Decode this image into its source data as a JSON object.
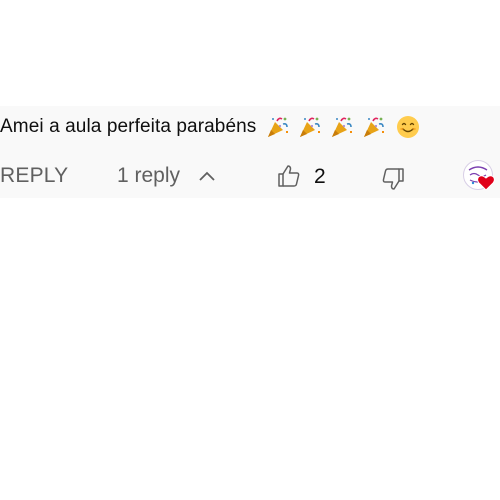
{
  "comment": {
    "text": "Amei a aula perfeita parabéns",
    "emojis": [
      "party-popper-icon",
      "party-popper-icon",
      "party-popper-icon",
      "party-popper-icon",
      "smiling-face-icon"
    ]
  },
  "actions": {
    "reply_label": "REPLY",
    "replies_label": "1 reply",
    "like_count": "2"
  },
  "colors": {
    "strip_background": "#f9f9f9",
    "secondary_text": "#606060",
    "primary_text": "#0f0f0f",
    "heart": "#e0001a"
  }
}
